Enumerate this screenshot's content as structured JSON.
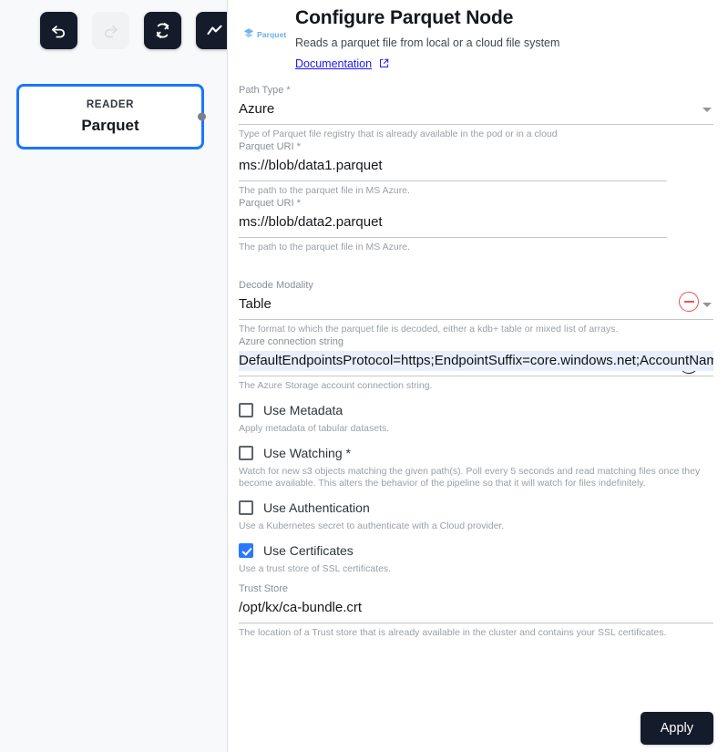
{
  "canvas": {
    "toolbar": [
      {
        "name": "undo-button",
        "icon": "undo-icon",
        "enabled": true
      },
      {
        "name": "redo-button",
        "icon": "redo-icon",
        "enabled": false
      },
      {
        "name": "refresh-button",
        "icon": "refresh-icon",
        "enabled": true
      },
      {
        "name": "metrics-button",
        "icon": "chart-line-icon",
        "enabled": true
      }
    ],
    "node": {
      "kind": "READER",
      "title": "Parquet",
      "selected": true,
      "border_color": "#1976ff",
      "port_color": "#7b8085"
    }
  },
  "config": {
    "brand": {
      "logo_icon": "parquet-diamond-icon",
      "logo_text": "Parquet",
      "logo_color": "#6aaee8"
    },
    "title": "Configure Parquet Node",
    "subtitle": "Reads a parquet file from local or a cloud file system",
    "documentation_link": "Documentation",
    "documentation_icon": "external-link-icon",
    "fields": {
      "path_type": {
        "label": "Path Type *",
        "value": "Azure",
        "help": "Type of Parquet file registry that is already available in the pod or in a cloud",
        "control": "select"
      },
      "parquet_uri_1": {
        "label": "Parquet URI *",
        "value": "ms://blob/data1.parquet",
        "help": "The path to the parquet file in MS Azure.",
        "control": "text"
      },
      "parquet_uri_2": {
        "label": "Parquet URI *",
        "value": "ms://blob/data2.parquet",
        "help": "The path to the parquet file in MS Azure.",
        "control": "text"
      },
      "decode_modality": {
        "label": "Decode Modality",
        "value": "Table",
        "help": "The format to which the parquet file is decoded, either a kdb+ table or mixed list of arrays.",
        "control": "select"
      },
      "azure_connection_string": {
        "label": "Azure connection string",
        "value": "DefaultEndpointsProtocol=https;EndpointSuffix=core.windows.net;AccountName=kx",
        "help": "The Azure Storage account connection string.",
        "control": "text",
        "highlighted": true
      },
      "trust_store": {
        "label": "Trust Store",
        "value": "/opt/kx/ca-bundle.crt",
        "help": "The location of a Trust store that is already available in the cluster and contains your SSL certificates.",
        "control": "text"
      }
    },
    "checkboxes": {
      "use_metadata": {
        "label": "Use Metadata",
        "checked": false,
        "help": "Apply metadata of tabular datasets."
      },
      "use_watching": {
        "label": "Use Watching *",
        "checked": false,
        "help": "Watch for new s3 objects matching the given path(s). Poll every 5 seconds and read matching files once they become available. This alters the behavior of the pipeline so that it will watch for files indefinitely."
      },
      "use_authentication": {
        "label": "Use Authentication",
        "checked": false,
        "help": "Use a Kubernetes secret to authenticate with a Cloud provider."
      },
      "use_certificates": {
        "label": "Use Certificates",
        "checked": true,
        "help": "Use a trust store of SSL certificates.",
        "accent_color": "#2979ff"
      }
    },
    "row_actions": {
      "remove_icon": "minus-circle-icon",
      "remove_color": "#ef5350",
      "add_icon": "plus-circle-icon",
      "add_color": "#15181c"
    },
    "footer": {
      "apply_label": "Apply",
      "apply_color": "#141c2b"
    }
  }
}
